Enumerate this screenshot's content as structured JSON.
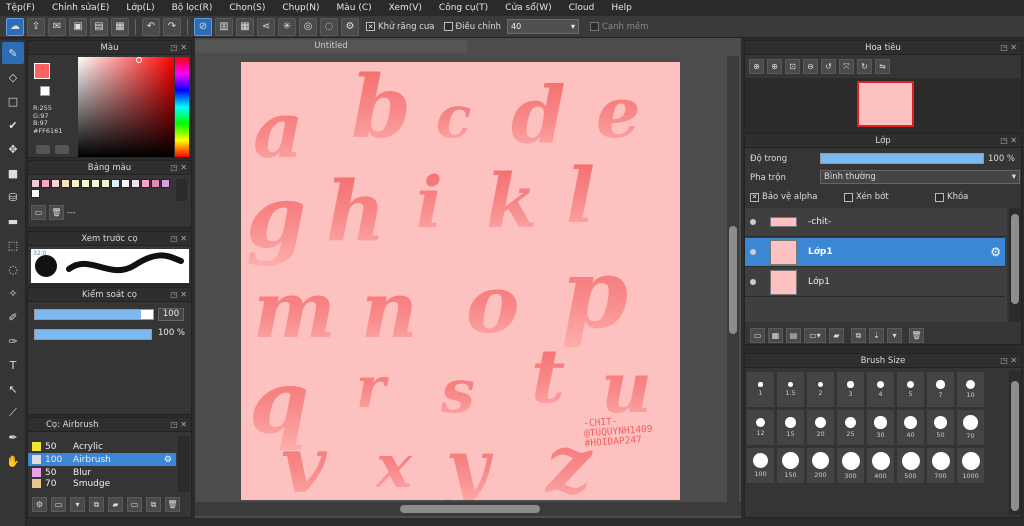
{
  "menu": [
    "Tệp(F)",
    "Chỉnh sửa(E)",
    "Lớp(L)",
    "Bộ lọc(R)",
    "Chọn(S)",
    "Chụp(N)",
    "Màu (C)",
    "Xem(V)",
    "Công cụ(T)",
    "Cửa sổ(W)",
    "Cloud",
    "Help"
  ],
  "toolbar": {
    "antialias_label": "Khử răng cưa",
    "adjust_label": "Điều chỉnh",
    "adjust_value": "40",
    "soft_edge_label": "Cạnh mềm"
  },
  "color_panel": {
    "title": "Màu",
    "r": "R:255",
    "g": "G:97",
    "b": "B:97",
    "hex": "#FF6161",
    "fg": "#ff6161"
  },
  "palette_panel": {
    "title": "Bảng màu",
    "footer": "---",
    "swatches": [
      "#f0c8d0",
      "#f8a8c0",
      "#f8d0d8",
      "#f8e0c0",
      "#f8f0c8",
      "#f8f8d0",
      "#f8f8e0",
      "#e8f8d0",
      "#e0f0f8",
      "#f8f8f8",
      "#f0e0f0",
      "#f8a0c8",
      "#e08ab0",
      "#d8a0e0",
      "#f8f8f8"
    ]
  },
  "preview_panel": {
    "title": "Xem trước cọ",
    "size_label": "32.0"
  },
  "control_panel": {
    "title": "Kiểm soát cọ",
    "size_value": "100",
    "opacity_value": "100 %"
  },
  "brush_panel": {
    "title": "Cọ: Airbrush",
    "brushes": [
      {
        "size": "50",
        "name": "Acrylic",
        "color": "#f2e23a"
      },
      {
        "size": "100",
        "name": "Airbrush",
        "color": "#dddddd"
      },
      {
        "size": "50",
        "name": "Blur",
        "color": "#e6a0e6"
      },
      {
        "size": "70",
        "name": "Smudge",
        "color": "#e8c890"
      }
    ]
  },
  "document": {
    "title": "Untitled",
    "credit1": "-CHIT-",
    "credit2": "@TUQUYNH1409",
    "credit3": "#HOIDAP247"
  },
  "letters": [
    "a",
    "b",
    "c",
    "d",
    "e",
    "g",
    "h",
    "i",
    "k",
    "l",
    "m",
    "n",
    "o",
    "p",
    "q",
    "r",
    "s",
    "t",
    "u",
    "v",
    "x",
    "y",
    "z"
  ],
  "navigator_panel": {
    "title": "Hoa tiêu"
  },
  "layers_panel": {
    "title": "Lớp",
    "opacity_label": "Độ trong",
    "opacity_value": "100 %",
    "blend_label": "Pha trộn",
    "blend_value": "Bình thường",
    "alpha_label": "Bảo vệ alpha",
    "clip_label": "Xén bớt",
    "lock_label": "Khóa",
    "layers": [
      {
        "name": "-chit-"
      },
      {
        "name": "Lớp1"
      },
      {
        "name": "Lớp1"
      }
    ]
  },
  "brush_size_panel": {
    "title": "Brush Size",
    "sizes": [
      "1",
      "1.5",
      "2",
      "3",
      "4",
      "5",
      "7",
      "10",
      "12",
      "15",
      "20",
      "25",
      "30",
      "40",
      "50",
      "70",
      "100",
      "150",
      "200",
      "300",
      "400",
      "500",
      "700",
      "1000"
    ]
  }
}
